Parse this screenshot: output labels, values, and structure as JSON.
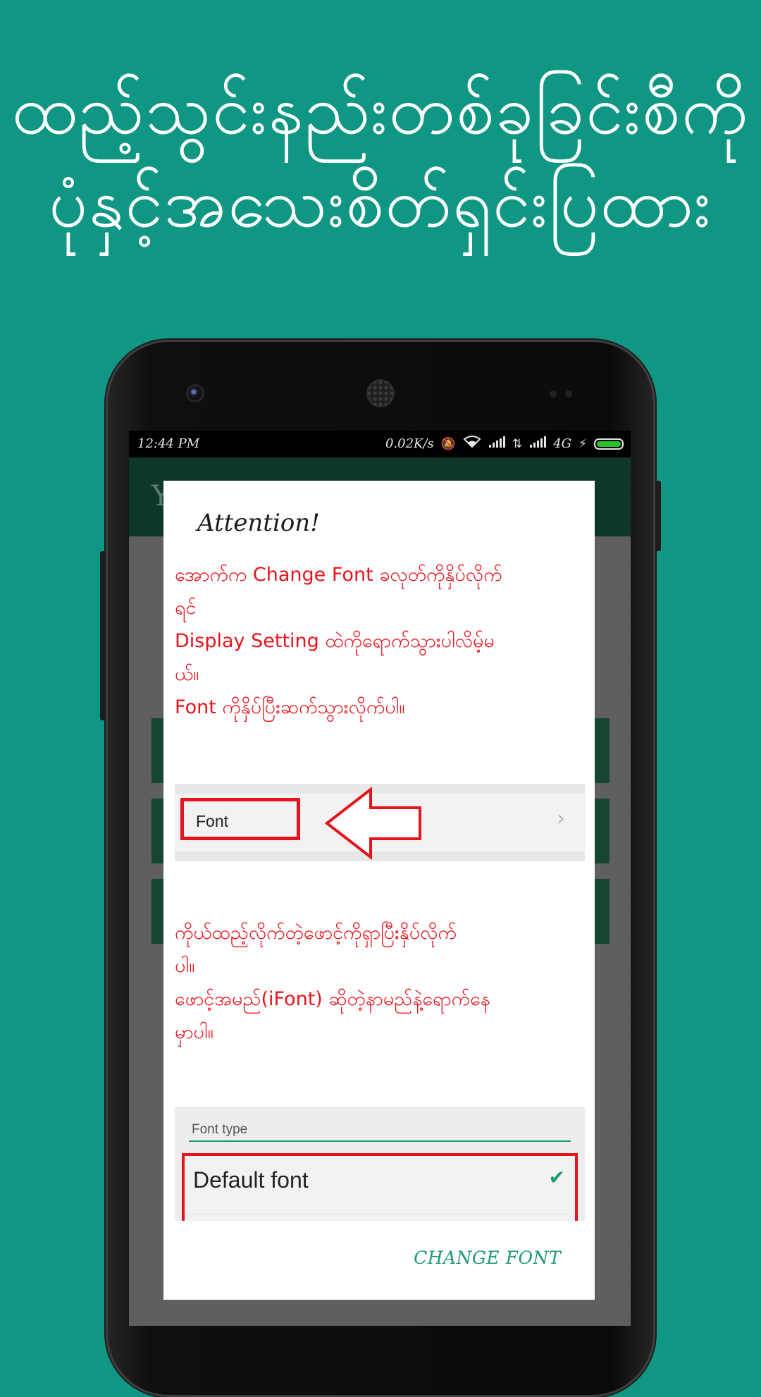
{
  "headline": {
    "line1": "ထည့်သွင်းနည်းတစ်ခုခြင်းစီကို",
    "line2": "ပုံနှင့်အသေးစိတ်ရှင်းပြထား"
  },
  "status_bar": {
    "time": "12:44 PM",
    "speed": "0.02K/s",
    "network": "4G",
    "icons": [
      "mute-icon",
      "wifi-icon",
      "signal-icon",
      "data-arrows-icon",
      "signal-icon",
      "charging-icon",
      "battery-icon"
    ],
    "battery_level": 1.0,
    "battery_color": "#27c22b"
  },
  "app_bar": {
    "title_partial": "Y"
  },
  "dialog": {
    "title": "Attention!",
    "message1_lines": [
      "အောက်က Change Font ခလုတ်ကိုနှိပ်လိုက်",
      "ရင်",
      "Display Setting ထဲကိုရောက်သွားပါလိမ့်မ",
      "ယ်။",
      "Font ကိုနှိပ်ပြီးဆက်သွားလိုက်ပါ။"
    ],
    "font_row_label": "Font",
    "message2_lines": [
      "ကိုယ်ထည့်လိုက်တဲ့ဖောင့်ကိုရှာပြီးနှိပ်လိုက်",
      "ပါ။",
      "ဖောင့်အမည်(iFont) ဆိုတဲ့နာမည်နဲ့ရောက်နေ",
      "မှာပါ။"
    ],
    "font_type_label": "Font type",
    "default_font_label": "Default font",
    "action_label": "CHANGE FONT"
  },
  "colors": {
    "background": "#0f9784",
    "accent_green": "#1e9a6c",
    "highlight_red": "#e3141b",
    "message_red": "#e8131b"
  }
}
